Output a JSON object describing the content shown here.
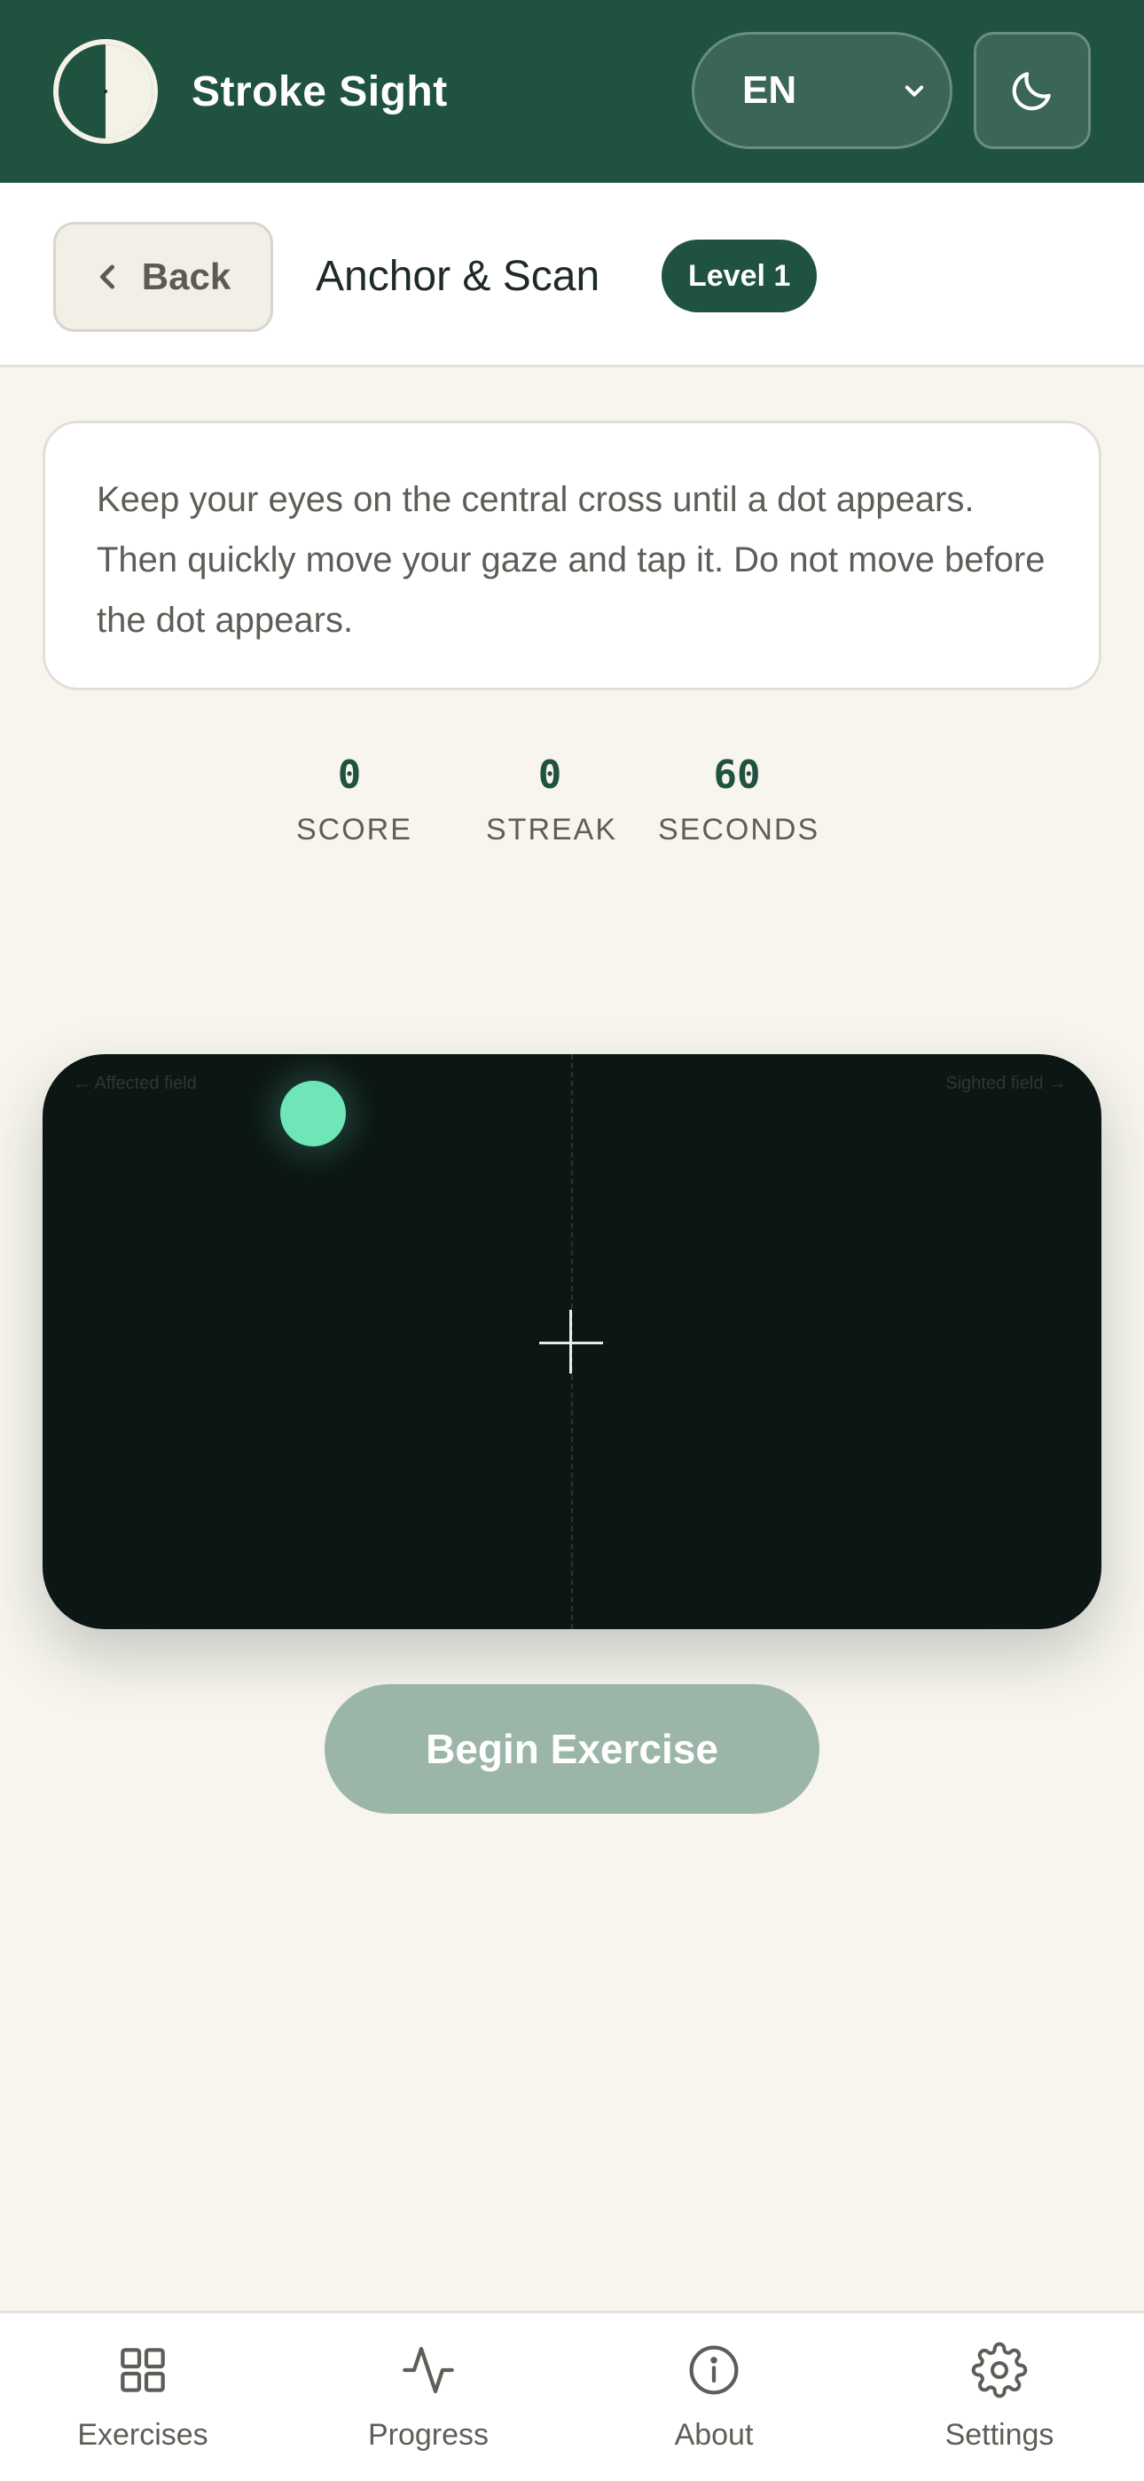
{
  "app": {
    "title": "Stroke Sight",
    "language": "EN",
    "logo_icon": "half-circle-logo-icon",
    "theme_toggle_icon": "moon-icon"
  },
  "exercise": {
    "back_label": "Back",
    "title": "Anchor & Scan",
    "level": "Level 1",
    "instructions": "Keep your eyes on the central cross until a dot appears. Then quickly move your gaze and tap it. Do not move before the dot appears."
  },
  "stats": {
    "score": {
      "value": "0",
      "label": "SCORE"
    },
    "streak": {
      "value": "0",
      "label": "STREAK"
    },
    "seconds": {
      "value": "60",
      "label": "SECONDS"
    }
  },
  "field": {
    "left_label": "← Affected field",
    "right_label": "Sighted field →",
    "target_color": "#6ee6b8"
  },
  "actions": {
    "begin_label": "Begin Exercise"
  },
  "nav": {
    "items": [
      {
        "label": "Exercises",
        "icon": "grid-icon"
      },
      {
        "label": "Progress",
        "icon": "activity-icon"
      },
      {
        "label": "About",
        "icon": "info-icon"
      },
      {
        "label": "Settings",
        "icon": "gear-icon"
      }
    ]
  },
  "colors": {
    "brand": "#205240",
    "background": "#f7f5ee",
    "field": "#0c1715",
    "begin_disabled": "#9bb6a8"
  }
}
